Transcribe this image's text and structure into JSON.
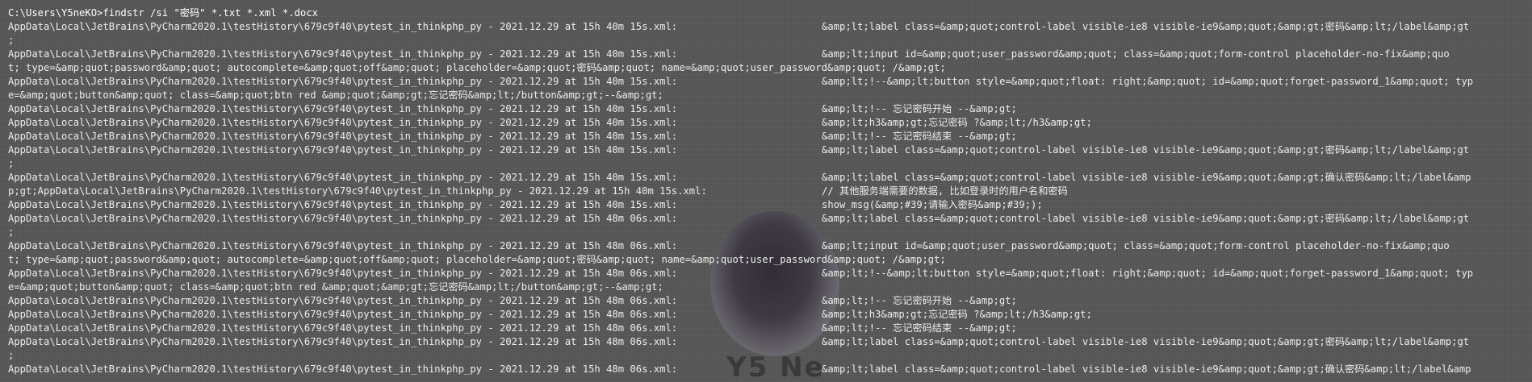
{
  "window": {
    "prompt": "C:\\Users\\Y5neKO>findstr /si \"密码\" *.txt *.xml *.docx"
  },
  "watermark_text": "Y5 Ne",
  "lines": [
    {
      "path": "AppData\\Local\\JetBrains\\PyCharm2020.1\\testHistory\\679c9f40\\pytest_in_thinkphp_py - 2021.12.29 at 15h 40m 15s.xml:",
      "match": "&amp;lt;label class=&amp;quot;control-label visible-ie8 visible-ie9&amp;quot;&amp;gt;密码&amp;lt;/label&amp;gt"
    },
    {
      "path": ";",
      "match": ""
    },
    {
      "path": "AppData\\Local\\JetBrains\\PyCharm2020.1\\testHistory\\679c9f40\\pytest_in_thinkphp_py - 2021.12.29 at 15h 40m 15s.xml:",
      "match": "&amp;lt;input id=&amp;quot;user_password&amp;quot; class=&amp;quot;form-control placeholder-no-fix&amp;quo"
    },
    {
      "path": "t; type=&amp;quot;password&amp;quot; autocomplete=&amp;quot;off&amp;quot; placeholder=&amp;quot;密码&amp;quot; name=&amp;quot;user_password&amp;quot; /&amp;gt;",
      "match": ""
    },
    {
      "path": "AppData\\Local\\JetBrains\\PyCharm2020.1\\testHistory\\679c9f40\\pytest_in_thinkphp_py - 2021.12.29 at 15h 40m 15s.xml:",
      "match": "&amp;lt;!--&amp;lt;button style=&amp;quot;float: right;&amp;quot; id=&amp;quot;forget-password_1&amp;quot; typ"
    },
    {
      "path": "e=&amp;quot;button&amp;quot; class=&amp;quot;btn red &amp;quot;&amp;gt;忘记密码&amp;lt;/button&amp;gt;--&amp;gt;",
      "match": ""
    },
    {
      "path": "AppData\\Local\\JetBrains\\PyCharm2020.1\\testHistory\\679c9f40\\pytest_in_thinkphp_py - 2021.12.29 at 15h 40m 15s.xml:",
      "match": "&amp;lt;!-- 忘记密码开始 --&amp;gt;"
    },
    {
      "path": "AppData\\Local\\JetBrains\\PyCharm2020.1\\testHistory\\679c9f40\\pytest_in_thinkphp_py - 2021.12.29 at 15h 40m 15s.xml:",
      "match": "&amp;lt;h3&amp;gt;忘记密码 ?&amp;lt;/h3&amp;gt;"
    },
    {
      "path": "AppData\\Local\\JetBrains\\PyCharm2020.1\\testHistory\\679c9f40\\pytest_in_thinkphp_py - 2021.12.29 at 15h 40m 15s.xml:",
      "match": "&amp;lt;!-- 忘记密码结束 --&amp;gt;"
    },
    {
      "path": "AppData\\Local\\JetBrains\\PyCharm2020.1\\testHistory\\679c9f40\\pytest_in_thinkphp_py - 2021.12.29 at 15h 40m 15s.xml:",
      "match": "&amp;lt;label class=&amp;quot;control-label visible-ie8 visible-ie9&amp;quot;&amp;gt;密码&amp;lt;/label&amp;gt"
    },
    {
      "path": ";",
      "match": ""
    },
    {
      "path": "AppData\\Local\\JetBrains\\PyCharm2020.1\\testHistory\\679c9f40\\pytest_in_thinkphp_py - 2021.12.29 at 15h 40m 15s.xml:",
      "match": "&amp;lt;label class=&amp;quot;control-label visible-ie8 visible-ie9&amp;quot;&amp;gt;确认密码&amp;lt;/label&amp"
    },
    {
      "path": "p;gt;AppData\\Local\\JetBrains\\PyCharm2020.1\\testHistory\\679c9f40\\pytest_in_thinkphp_py - 2021.12.29 at 15h 40m 15s.xml:",
      "match": "// 其他服务端需要的数据, 比如登录时的用户名和密码"
    },
    {
      "path": "AppData\\Local\\JetBrains\\PyCharm2020.1\\testHistory\\679c9f40\\pytest_in_thinkphp_py - 2021.12.29 at 15h 40m 15s.xml:",
      "match": "show_msg(&amp;#39;请输入密码&amp;#39;);"
    },
    {
      "path": "AppData\\Local\\JetBrains\\PyCharm2020.1\\testHistory\\679c9f40\\pytest_in_thinkphp_py - 2021.12.29 at 15h 48m 06s.xml:",
      "match": "&amp;lt;label class=&amp;quot;control-label visible-ie8 visible-ie9&amp;quot;&amp;gt;密码&amp;lt;/label&amp;gt"
    },
    {
      "path": ";",
      "match": ""
    },
    {
      "path": "AppData\\Local\\JetBrains\\PyCharm2020.1\\testHistory\\679c9f40\\pytest_in_thinkphp_py - 2021.12.29 at 15h 48m 06s.xml:",
      "match": "&amp;lt;input id=&amp;quot;user_password&amp;quot; class=&amp;quot;form-control placeholder-no-fix&amp;quo"
    },
    {
      "path": "t; type=&amp;quot;password&amp;quot; autocomplete=&amp;quot;off&amp;quot; placeholder=&amp;quot;密码&amp;quot; name=&amp;quot;user_password&amp;quot; /&amp;gt;",
      "match": ""
    },
    {
      "path": "AppData\\Local\\JetBrains\\PyCharm2020.1\\testHistory\\679c9f40\\pytest_in_thinkphp_py - 2021.12.29 at 15h 48m 06s.xml:",
      "match": "&amp;lt;!--&amp;lt;button style=&amp;quot;float: right;&amp;quot; id=&amp;quot;forget-password_1&amp;quot; typ"
    },
    {
      "path": "e=&amp;quot;button&amp;quot; class=&amp;quot;btn red &amp;quot;&amp;gt;忘记密码&amp;lt;/button&amp;gt;--&amp;gt;",
      "match": ""
    },
    {
      "path": "AppData\\Local\\JetBrains\\PyCharm2020.1\\testHistory\\679c9f40\\pytest_in_thinkphp_py - 2021.12.29 at 15h 48m 06s.xml:",
      "match": "&amp;lt;!-- 忘记密码开始 --&amp;gt;"
    },
    {
      "path": "AppData\\Local\\JetBrains\\PyCharm2020.1\\testHistory\\679c9f40\\pytest_in_thinkphp_py - 2021.12.29 at 15h 48m 06s.xml:",
      "match": "&amp;lt;h3&amp;gt;忘记密码 ?&amp;lt;/h3&amp;gt;"
    },
    {
      "path": "AppData\\Local\\JetBrains\\PyCharm2020.1\\testHistory\\679c9f40\\pytest_in_thinkphp_py - 2021.12.29 at 15h 48m 06s.xml:",
      "match": "&amp;lt;!-- 忘记密码结束 --&amp;gt;"
    },
    {
      "path": "AppData\\Local\\JetBrains\\PyCharm2020.1\\testHistory\\679c9f40\\pytest_in_thinkphp_py - 2021.12.29 at 15h 48m 06s.xml:",
      "match": "&amp;lt;label class=&amp;quot;control-label visible-ie8 visible-ie9&amp;quot;&amp;gt;密码&amp;lt;/label&amp;gt"
    },
    {
      "path": ";",
      "match": ""
    },
    {
      "path": "AppData\\Local\\JetBrains\\PyCharm2020.1\\testHistory\\679c9f40\\pytest_in_thinkphp_py - 2021.12.29 at 15h 48m 06s.xml:",
      "match": "&amp;lt;label class=&amp;quot;control-label visible-ie8 visible-ie9&amp;quot;&amp;gt;确认密码&amp;lt;/label&amp"
    }
  ]
}
